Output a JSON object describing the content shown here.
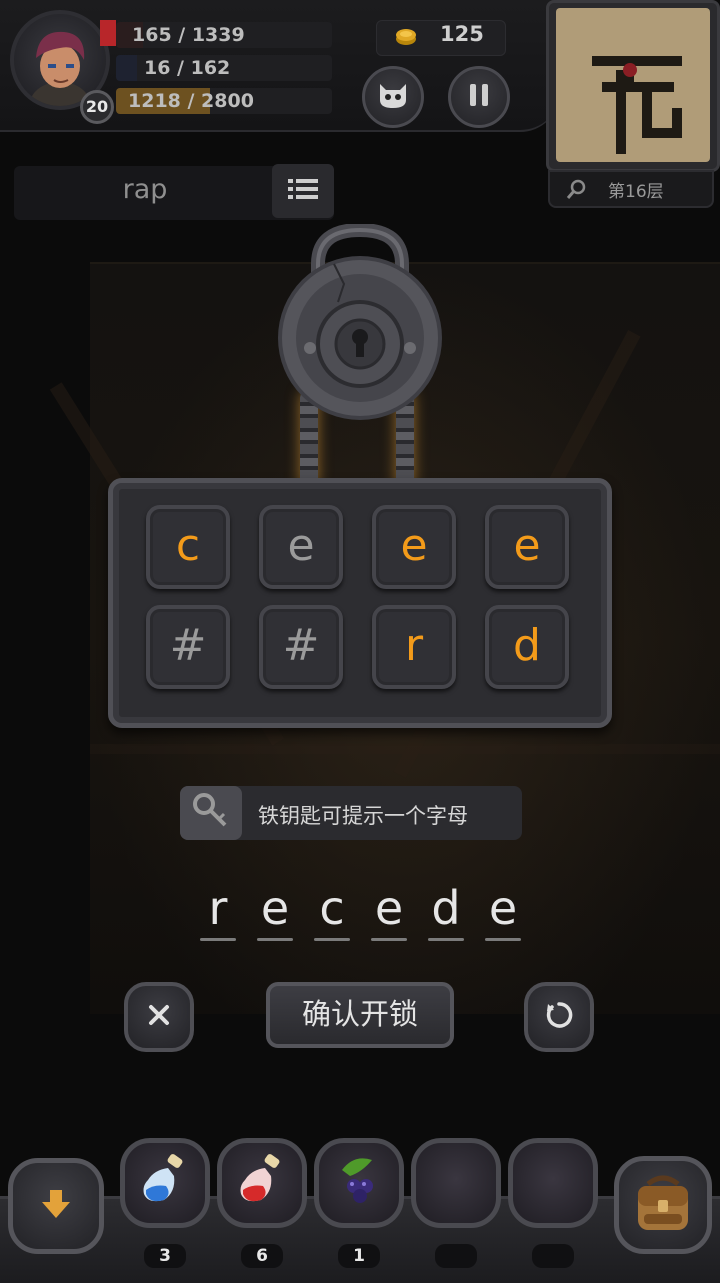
{
  "hud": {
    "hp": "165 / 1339",
    "hp_fraction": 0.123,
    "mp": "16 / 162",
    "mp_fraction": 0.099,
    "xp": "1218 / 2800",
    "xp_fraction": 0.435,
    "level": "20",
    "gold": "125"
  },
  "minimap": {
    "floor": "第16层"
  },
  "clue": {
    "word": "rap"
  },
  "board": {
    "tiles": [
      {
        "letter": "c",
        "active": true
      },
      {
        "letter": "e",
        "active": false
      },
      {
        "letter": "e",
        "active": true
      },
      {
        "letter": "e",
        "active": true
      },
      {
        "letter": "#",
        "active": false
      },
      {
        "letter": "#",
        "active": false
      },
      {
        "letter": "r",
        "active": true
      },
      {
        "letter": "d",
        "active": true
      }
    ]
  },
  "hint": {
    "text": "铁钥匙可提示一个字母"
  },
  "answer": {
    "letters": [
      "r",
      "e",
      "c",
      "e",
      "d",
      "e"
    ]
  },
  "actions": {
    "confirm_label": "确认开锁"
  },
  "inventory": {
    "slots": [
      {
        "item": "blue-potion",
        "count": "3"
      },
      {
        "item": "red-potion",
        "count": "6"
      },
      {
        "item": "berries",
        "count": "1"
      },
      {
        "item": "empty",
        "count": ""
      },
      {
        "item": "empty",
        "count": ""
      }
    ]
  },
  "colors": {
    "active_letter": "#f39b1a",
    "inactive_letter": "#9b9b9b",
    "hp": "#b8262a",
    "xp": "#7a5a1e"
  }
}
